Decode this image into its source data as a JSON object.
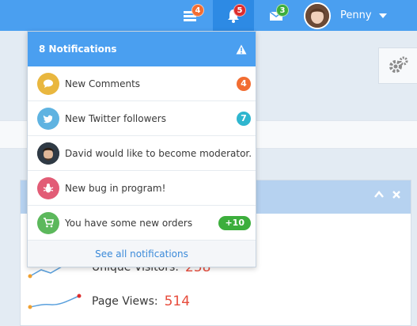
{
  "navbar": {
    "tasks_badge": "4",
    "notifications_badge": "5",
    "messages_badge": "3",
    "user_name": "Penny",
    "colors": {
      "bar": "#4a9ff0",
      "active": "#2d8ae4",
      "orange": "#f26d32",
      "red": "#dd2c2c",
      "green": "#3cae3c"
    }
  },
  "notifications": {
    "header": "8 Notifications",
    "items": [
      {
        "label": "New Comments",
        "icon": "comment-icon",
        "icon_color": "#e9b73f",
        "badge": "4",
        "badge_color": "#f26d32"
      },
      {
        "label": "New Twitter followers",
        "icon": "twitter-icon",
        "icon_color": "#5fb3e1",
        "badge": "7",
        "badge_color": "#2fb6cf"
      },
      {
        "label": "David would like to become moderator.",
        "icon": "user-avatar",
        "icon_color": "#3d3d3d",
        "badge": "",
        "badge_color": ""
      },
      {
        "label": "New bug in program!",
        "icon": "bug-icon",
        "icon_color": "#e25c76",
        "badge": "",
        "badge_color": ""
      },
      {
        "label": "You have some new orders",
        "icon": "cart-icon",
        "icon_color": "#5cb85c",
        "badge": "+10",
        "badge_color": "#3cae3c"
      }
    ],
    "footer": "See all notifications"
  },
  "stats": {
    "unique_visitors_label": "Unique Visitors:",
    "unique_visitors_value": "258",
    "page_views_label": "Page Views:",
    "page_views_value": "514"
  }
}
